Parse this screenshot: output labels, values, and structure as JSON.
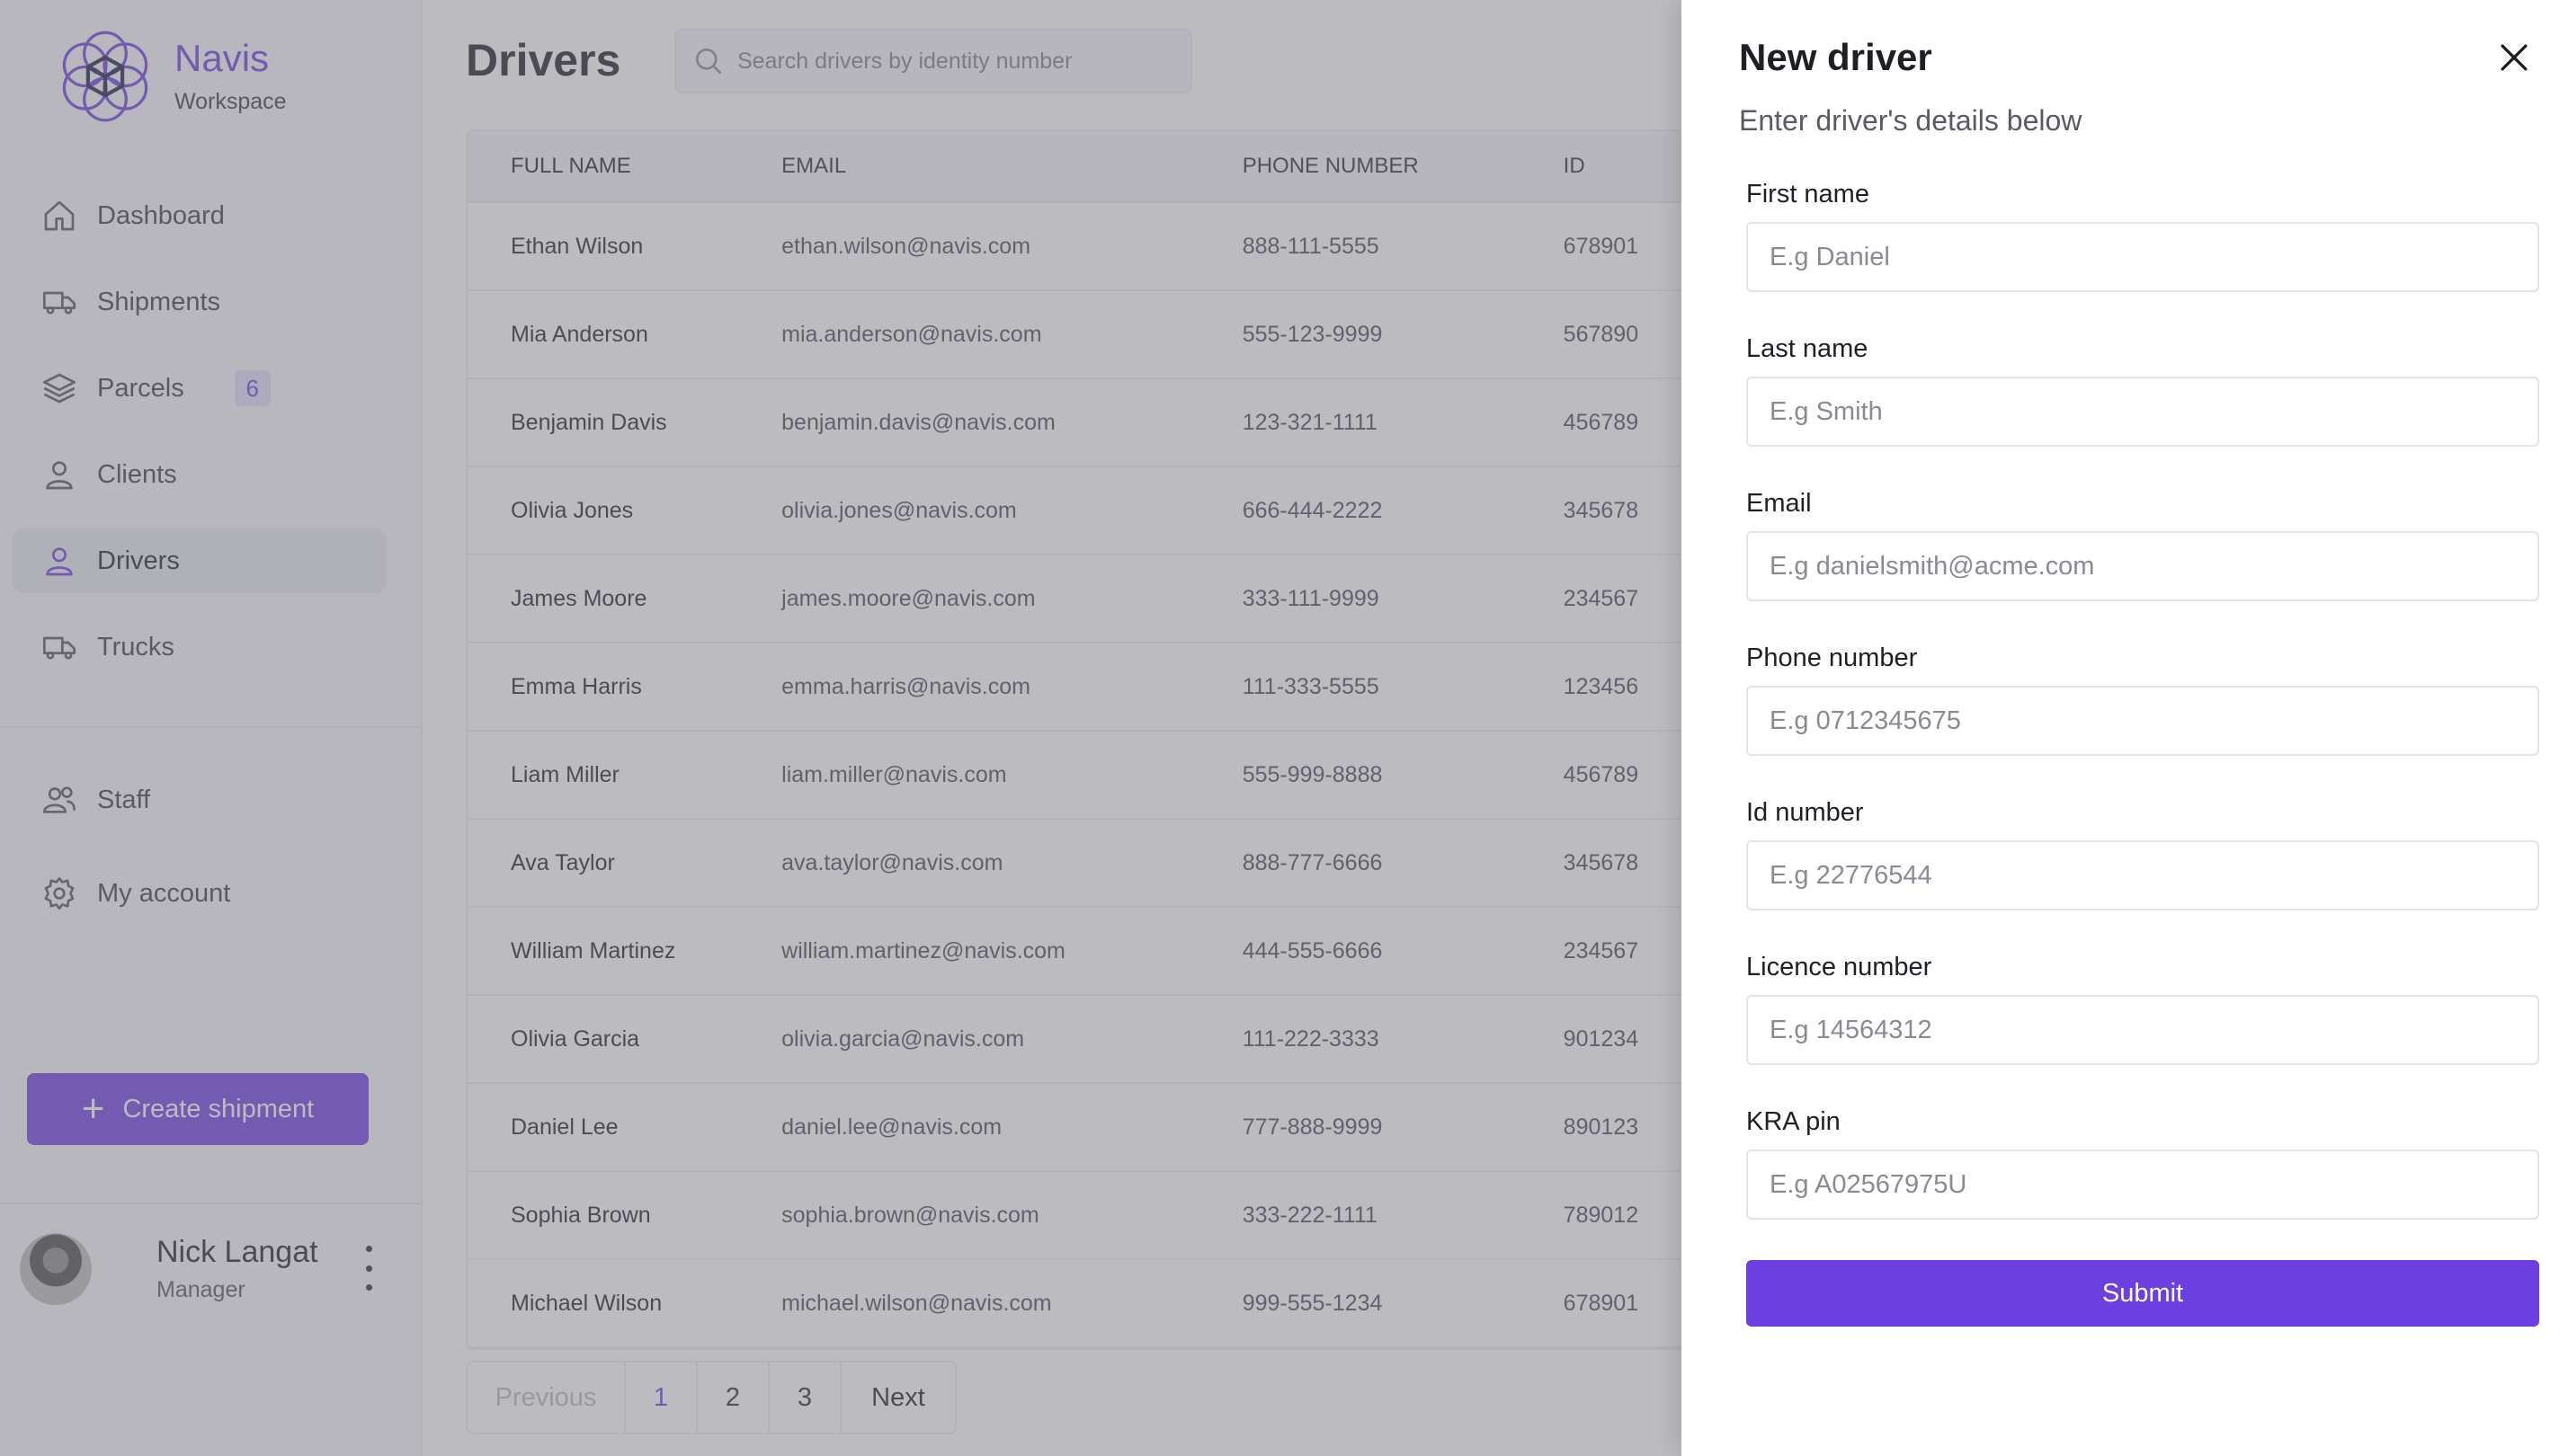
{
  "brand": {
    "name": "Navis",
    "subtitle": "Workspace"
  },
  "sidebar": {
    "items": [
      {
        "label": "Dashboard"
      },
      {
        "label": "Shipments"
      },
      {
        "label": "Parcels",
        "badge": "6"
      },
      {
        "label": "Clients"
      },
      {
        "label": "Drivers"
      },
      {
        "label": "Trucks"
      }
    ],
    "secondary": [
      {
        "label": "Staff"
      },
      {
        "label": "My account"
      }
    ],
    "create_label": "Create shipment",
    "user": {
      "name": "Nick Langat",
      "role": "Manager"
    }
  },
  "main": {
    "title": "Drivers",
    "search_placeholder": "Search drivers by identity number",
    "columns": [
      "FULL NAME",
      "EMAIL",
      "PHONE NUMBER",
      "ID"
    ],
    "rows": [
      [
        "Ethan Wilson",
        "ethan.wilson@navis.com",
        "888-111-5555",
        "678901"
      ],
      [
        "Mia Anderson",
        "mia.anderson@navis.com",
        "555-123-9999",
        "567890"
      ],
      [
        "Benjamin Davis",
        "benjamin.davis@navis.com",
        "123-321-1111",
        "456789"
      ],
      [
        "Olivia Jones",
        "olivia.jones@navis.com",
        "666-444-2222",
        "345678"
      ],
      [
        "James Moore",
        "james.moore@navis.com",
        "333-111-9999",
        "234567"
      ],
      [
        "Emma Harris",
        "emma.harris@navis.com",
        "111-333-5555",
        "123456"
      ],
      [
        "Liam Miller",
        "liam.miller@navis.com",
        "555-999-8888",
        "456789"
      ],
      [
        "Ava Taylor",
        "ava.taylor@navis.com",
        "888-777-6666",
        "345678"
      ],
      [
        "William Martinez",
        "william.martinez@navis.com",
        "444-555-6666",
        "234567"
      ],
      [
        "Olivia Garcia",
        "olivia.garcia@navis.com",
        "111-222-3333",
        "901234"
      ],
      [
        "Daniel Lee",
        "daniel.lee@navis.com",
        "777-888-9999",
        "890123"
      ],
      [
        "Sophia Brown",
        "sophia.brown@navis.com",
        "333-222-1111",
        "789012"
      ],
      [
        "Michael Wilson",
        "michael.wilson@navis.com",
        "999-555-1234",
        "678901"
      ]
    ],
    "pagination": {
      "previous": "Previous",
      "pages": [
        "1",
        "2",
        "3"
      ],
      "current": "1",
      "next": "Next"
    }
  },
  "drawer": {
    "title": "New driver",
    "subtitle": "Enter driver's details below",
    "fields": [
      {
        "label": "First name",
        "placeholder": "E.g Daniel"
      },
      {
        "label": "Last name",
        "placeholder": "E.g Smith"
      },
      {
        "label": "Email",
        "placeholder": "E.g danielsmith@acme.com"
      },
      {
        "label": "Phone number",
        "placeholder": "E.g 0712345675"
      },
      {
        "label": "Id number",
        "placeholder": "E.g 22776544"
      },
      {
        "label": "Licence number",
        "placeholder": "E.g 14564312"
      },
      {
        "label": "KRA pin",
        "placeholder": "E.g A02567975U"
      }
    ],
    "submit_label": "Submit"
  },
  "colors": {
    "accent": "#6d3fe0",
    "overlay": "rgba(120,120,130,0.5)"
  }
}
